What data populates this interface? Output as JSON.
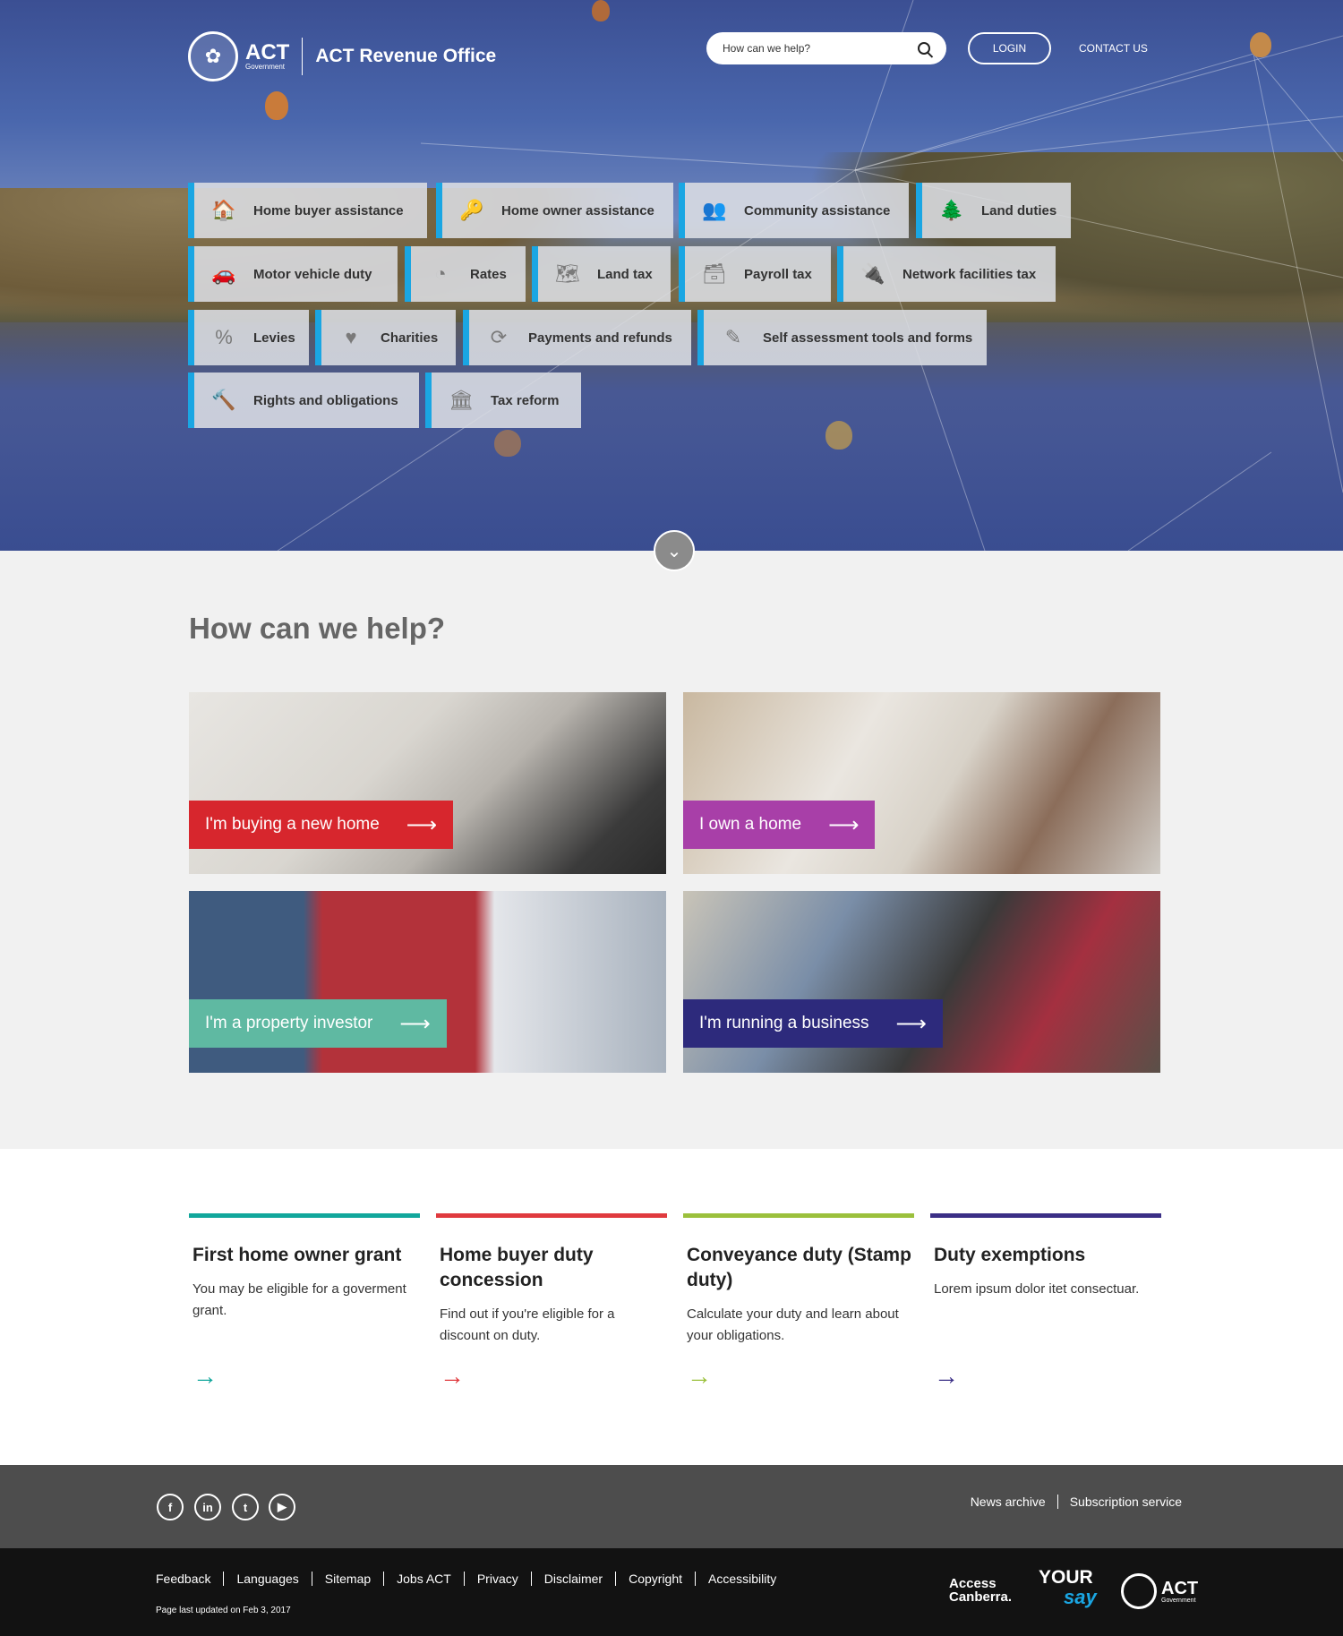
{
  "header": {
    "logo_seal_symbol": "✿",
    "logo_act": "ACT",
    "logo_government": "Government",
    "site_title": "ACT Revenue Office",
    "search_placeholder": "How can we help?",
    "login_label": "LOGIN",
    "contact_label": "CONTACT US"
  },
  "tiles": [
    {
      "label": "Home buyer assistance",
      "icon": "🏠"
    },
    {
      "label": "Home owner assistance",
      "icon": "🔑"
    },
    {
      "label": "Community assistance",
      "icon": "👥"
    },
    {
      "label": "Land duties",
      "icon": "🌲"
    },
    {
      "label": "Motor vehicle duty",
      "icon": "🚗"
    },
    {
      "label": "Rates",
      "icon": "◔"
    },
    {
      "label": "Land tax",
      "icon": "🗺"
    },
    {
      "label": "Payroll tax",
      "icon": "🗃"
    },
    {
      "label": "Network facilities tax",
      "icon": "🔌"
    },
    {
      "label": "Levies",
      "icon": "%"
    },
    {
      "label": "Charities",
      "icon": "♥"
    },
    {
      "label": "Payments and refunds",
      "icon": "⟳"
    },
    {
      "label": "Self assessment tools and forms",
      "icon": "✎"
    },
    {
      "label": "Rights and obligations",
      "icon": "🔨"
    },
    {
      "label": "Tax reform",
      "icon": "🏛"
    }
  ],
  "scroll_icon": "⌄",
  "help": {
    "heading": "How can we help?",
    "cards": [
      {
        "label": "I'm buying a new home",
        "arrow": "⟶",
        "color": "#d7262d"
      },
      {
        "label": "I own a home",
        "arrow": "⟶",
        "color": "#a83fa8"
      },
      {
        "label": "I'm a property investor",
        "arrow": "⟶",
        "color": "#5fb9a2"
      },
      {
        "label": "I'm running a business",
        "arrow": "⟶",
        "color": "#2d2a7c"
      }
    ]
  },
  "features": [
    {
      "title": "First home owner grant",
      "text": "You may be eligible for a goverment grant.",
      "color": "#12a79c",
      "arrow": "→"
    },
    {
      "title": "Home buyer duty concession",
      "text": "Find out if you're eligible for a discount on duty.",
      "color": "#e03a3e",
      "arrow": "→"
    },
    {
      "title": "Conveyance duty (Stamp duty)",
      "text": "Calculate your duty and learn about your obligations.",
      "color": "#9bc03c",
      "arrow": "→"
    },
    {
      "title": "Duty exemptions",
      "text": "Lorem ipsum dolor itet consectuar.",
      "color": "#3b2f86",
      "arrow": "→"
    }
  ],
  "footer": {
    "social": [
      "f",
      "in",
      "t",
      "▶"
    ],
    "links": [
      "News archive",
      "Subscription service"
    ],
    "nav": [
      "Feedback",
      "Languages",
      "Sitemap",
      "Jobs ACT",
      "Privacy",
      "Disclaimer",
      "Copyright",
      "Accessibility"
    ],
    "updated": "Page last updated on Feb 3, 2017",
    "access_canberra_1": "Access",
    "access_canberra_2": "Canberra.",
    "yoursay_1": "YOUR",
    "yoursay_2": "say",
    "act_logo": "ACT",
    "act_logo_sub": "Government"
  }
}
